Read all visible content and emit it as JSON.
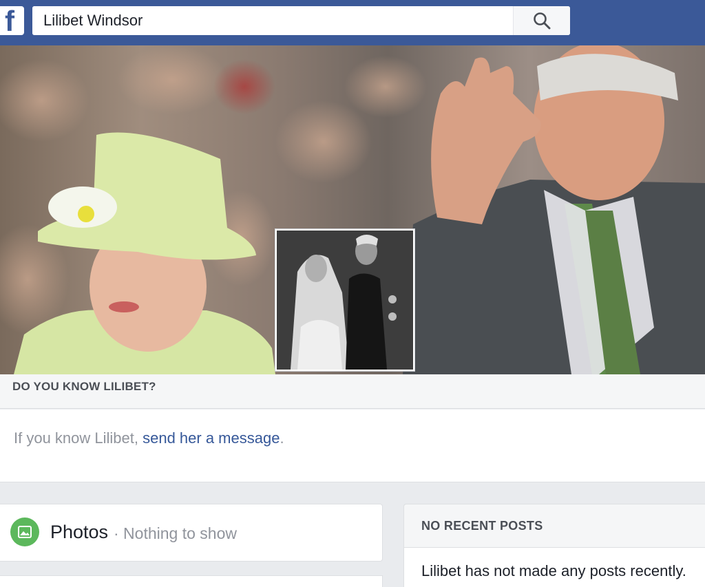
{
  "app": {
    "logo_letter": "f"
  },
  "search": {
    "value": "Lilibet Windsor"
  },
  "know_section": {
    "title": "DO YOU KNOW LILIBET?",
    "text_prefix": "If you know Lilibet, ",
    "link_text": "send her a message",
    "text_suffix": "."
  },
  "photos": {
    "title": "Photos",
    "separator_subtitle": " · Nothing to show",
    "icon": "photo-icon",
    "icon_color": "#5cb85c"
  },
  "posts": {
    "title": "NO RECENT POSTS",
    "text": "Lilibet has not made any posts recently."
  },
  "colors": {
    "brand": "#3b5998",
    "link": "#365899",
    "muted": "#90949c"
  }
}
